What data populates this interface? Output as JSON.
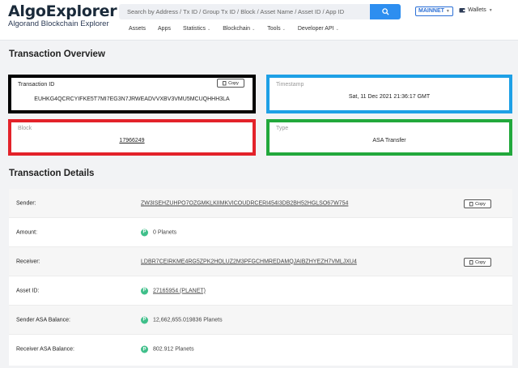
{
  "header": {
    "logo_title": "AlgoExplorer",
    "logo_subtitle": "Algorand Blockchain Explorer",
    "search_placeholder": "Search by Address / Tx ID / Group Tx ID / Block / Asset Name / Asset ID / App ID",
    "network": "MAINNET",
    "wallets": "Wallets",
    "nav": [
      {
        "label": "Assets",
        "has_dropdown": false
      },
      {
        "label": "Apps",
        "has_dropdown": false
      },
      {
        "label": "Statistics",
        "has_dropdown": true
      },
      {
        "label": "Blockchain",
        "has_dropdown": true
      },
      {
        "label": "Tools",
        "has_dropdown": true
      },
      {
        "label": "Developer API",
        "has_dropdown": true
      }
    ]
  },
  "overview": {
    "title": "Transaction Overview",
    "txid_label": "Transaction ID",
    "txid_value": "EUHKG4QCRCYIFKE5T7MI7EG3N7JRWEADVVXBV3VMU5MCUQHHH3LA",
    "copy": "Copy",
    "timestamp_label": "Timestamp",
    "timestamp_value": "Sat, 11 Dec 2021 21:36:17 GMT",
    "block_label": "Block",
    "block_value": "17966249",
    "type_label": "Type",
    "type_value": "ASA Transfer"
  },
  "details": {
    "title": "Transaction Details",
    "copy": "Copy",
    "rows": [
      {
        "label": "Sender:",
        "value": "ZW3ISEHZUHPO7OZGMKLKIIMKVICOUDRCERI454I3DB2BH52HGLSO67W754"
      },
      {
        "label": "Amount:",
        "value": "0 Planets"
      },
      {
        "label": "Receiver:",
        "value": "LDBR7CEIRKME4RG5ZPK2HOLUZ2M3PFGCHMREDAMQJAIBZHYEZH7VMLJXU4"
      },
      {
        "label": "Asset ID:",
        "value": "27165954 (PLANET)"
      },
      {
        "label": "Sender ASA Balance:",
        "value": "12,662,655.019836 Planets"
      },
      {
        "label": "Receiver ASA Balance:",
        "value": "802.912 Planets"
      }
    ]
  },
  "colors": {
    "accent": "#2d8ef0",
    "badge": "#3fbf8a",
    "box_txid": "#000000",
    "box_timestamp": "#1ea0e6",
    "box_block": "#e3222a",
    "box_type": "#22a83c"
  }
}
